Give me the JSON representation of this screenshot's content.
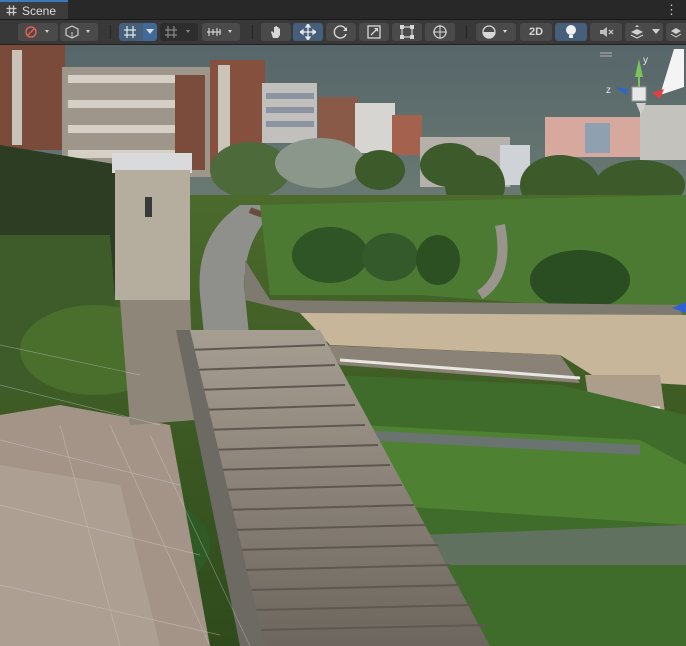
{
  "window": {
    "tab_label": "Scene",
    "tab_icon": "hash-grid-icon"
  },
  "toolbar": {
    "mode_2d_label": "2D",
    "tools": [
      "draw-mode",
      "shading",
      "grid-snap",
      "increment-snap",
      "ruler",
      "hand",
      "move",
      "rotate",
      "scale",
      "rect",
      "transform",
      "orientation",
      "2d",
      "lighting",
      "audio",
      "effects",
      "layers"
    ]
  },
  "colors": {
    "accent": "#3a79bb",
    "toolbar": "#383838",
    "tabbar": "#282828",
    "active_tool": "#46607c"
  },
  "gizmo": {
    "axis_y": "y",
    "axis_z": "z"
  }
}
